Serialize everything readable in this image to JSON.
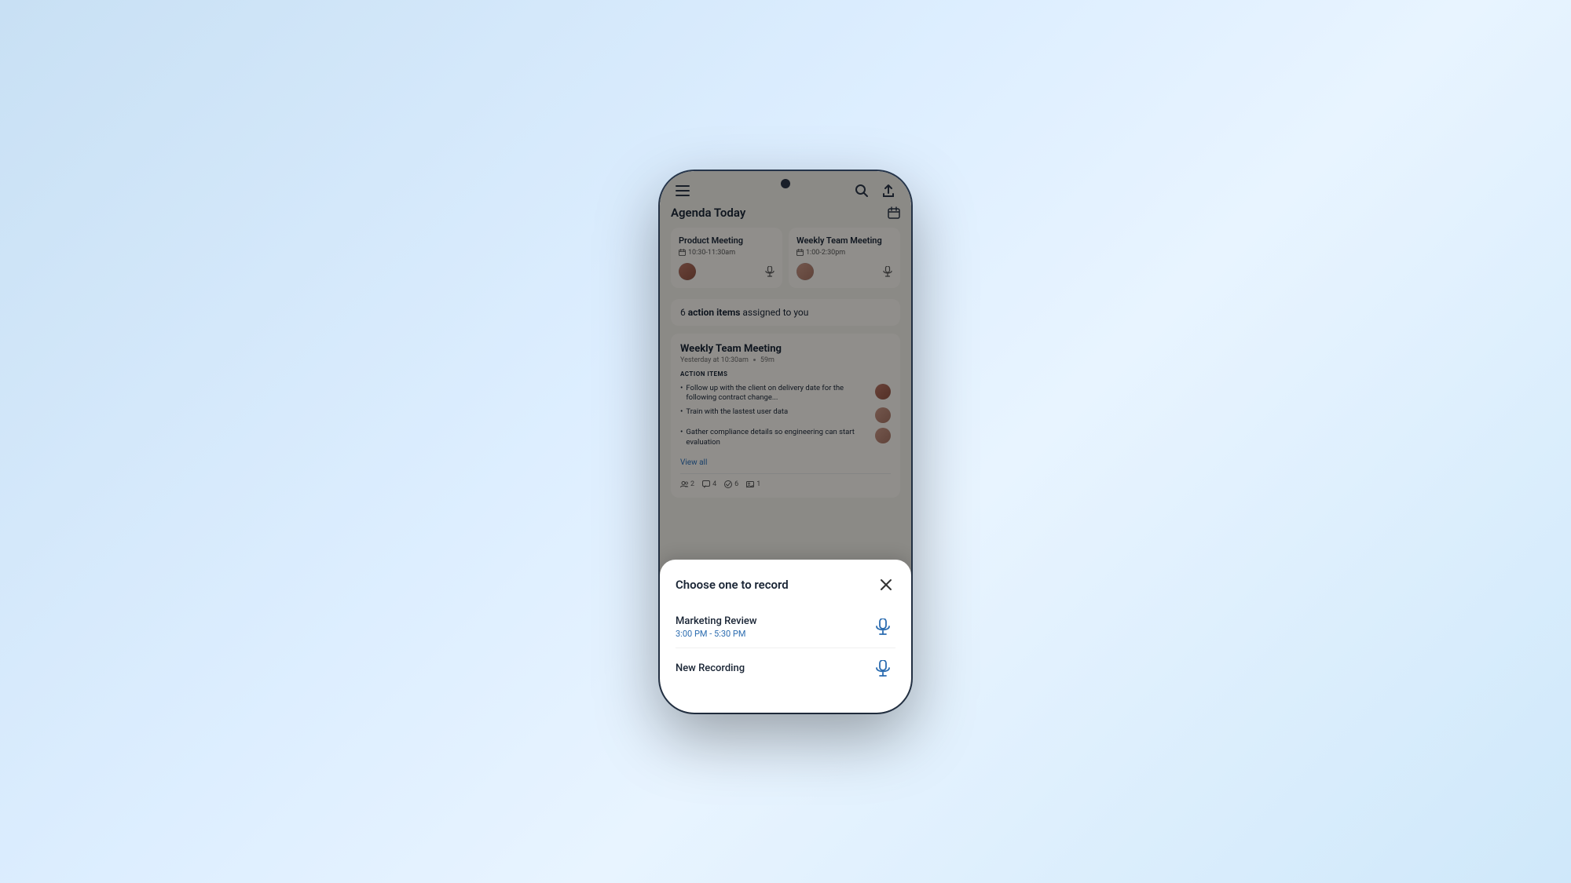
{
  "app": {
    "title": "Agenda Today"
  },
  "header": {
    "menu_label": "☰",
    "search_label": "search",
    "upload_label": "upload",
    "calendar_label": "calendar"
  },
  "meetings": {
    "cards": [
      {
        "title": "Product Meeting",
        "time": "10:30-11:30am"
      },
      {
        "title": "Weekly Team Meeting",
        "time": "1:00-2:30pm"
      }
    ]
  },
  "action_banner": {
    "count": "6",
    "text": "action items",
    "suffix": "assigned to you"
  },
  "meeting_detail": {
    "title": "Weekly Team Meeting",
    "date": "Yesterday at 10:30am",
    "duration": "59m",
    "section_label": "ACTION ITEMS",
    "items": [
      "Follow up with the client on delivery date for the following contract change...",
      "Train with the lastest user data",
      "Gather compliance details so engineering can start evaluation"
    ],
    "view_all": "View all",
    "stats": [
      {
        "icon": "💬",
        "value": "2"
      },
      {
        "icon": "🗨",
        "value": "4"
      },
      {
        "icon": "✓",
        "value": "6"
      },
      {
        "icon": "🖼",
        "value": "1"
      }
    ]
  },
  "bottom_sheet": {
    "title": "Choose one to record",
    "close_label": "×",
    "items": [
      {
        "name": "Marketing Review",
        "time": "3:00 PM - 5:30 PM"
      },
      {
        "name": "New Recording",
        "time": ""
      }
    ]
  }
}
